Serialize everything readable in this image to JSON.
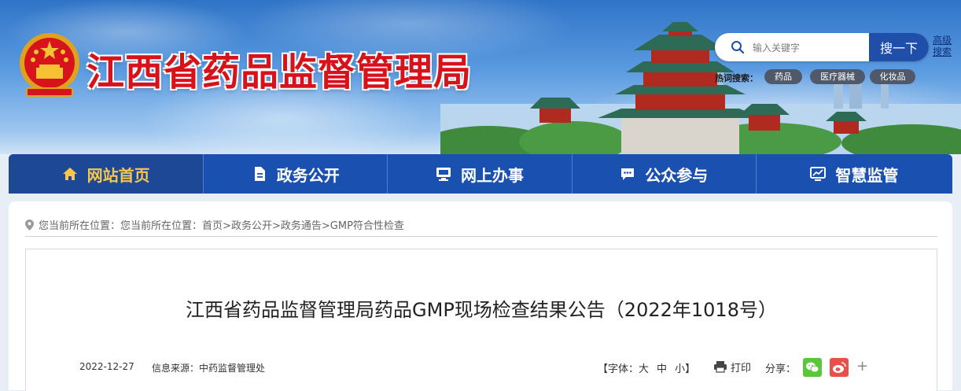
{
  "header": {
    "site_title": "江西省药品监督管理局",
    "search": {
      "placeholder": "输入关键字",
      "button_label": "搜一下",
      "advanced_label": "高级搜索"
    },
    "hot_search": {
      "label": "热词搜索：",
      "tags": [
        "药品",
        "医疗器械",
        "化妆品"
      ]
    }
  },
  "nav": {
    "items": [
      {
        "label": "网站首页",
        "icon": "home-icon",
        "active": true
      },
      {
        "label": "政务公开",
        "icon": "document-icon",
        "active": false
      },
      {
        "label": "网上办事",
        "icon": "monitor-icon",
        "active": false
      },
      {
        "label": "公众参与",
        "icon": "chat-icon",
        "active": false
      },
      {
        "label": "智慧监管",
        "icon": "dashboard-icon",
        "active": false
      }
    ]
  },
  "breadcrumb": {
    "prefix": "您当前所在位置：您当前所在位置：",
    "path": [
      "首页",
      "政务公开",
      "政务通告",
      "GMP符合性检查"
    ],
    "separator": ">"
  },
  "article": {
    "title": "江西省药品监督管理局药品GMP现场检查结果公告（2022年1018号）",
    "date": "2022-12-27",
    "source": "信息来源：中药监督管理处",
    "font_control": {
      "prefix": "【字体：",
      "sizes": [
        "大",
        "中",
        "小"
      ],
      "suffix": "】"
    },
    "print_label": "打印",
    "share_label": "分享："
  },
  "colors": {
    "title_red": "#d8121a",
    "nav_blue": "#1a50b0",
    "nav_active_text": "#f7c64a",
    "search_button": "#1f4fa9",
    "wechat_green": "#5ac73b",
    "weibo_red": "#e8504a"
  }
}
